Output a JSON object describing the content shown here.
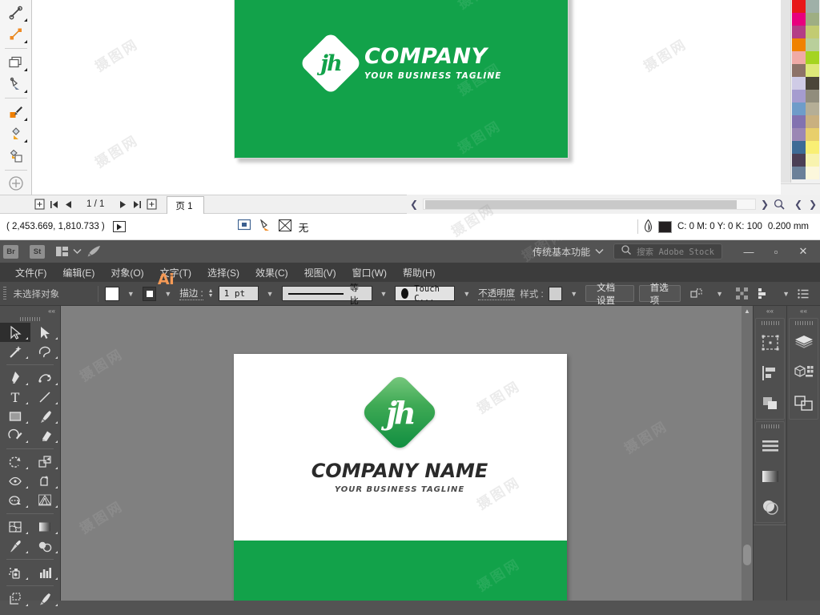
{
  "corel": {
    "toolbox": [
      {
        "name": "dimension-tool"
      },
      {
        "name": "connector-tool"
      },
      {
        "name": "rectangle-shape-tool"
      },
      {
        "name": "fill-tool"
      },
      {
        "name": "eyedropper-tool"
      },
      {
        "name": "interactive-fill-tool"
      },
      {
        "name": "smart-fill-tool"
      },
      {
        "name": "zoom-tool"
      }
    ],
    "artwork": {
      "company": "COMPANY",
      "tagline": "YOUR BUSINESS TAGLINE",
      "monogram": "jh",
      "green": "#12a24a"
    },
    "palette": {
      "left_column": [
        "#e81818",
        "#e8007d",
        "#b43d86",
        "#f08200",
        "#f0aaa6",
        "#8d7268",
        "#cfcbe6",
        "#a59ccf",
        "#6f9cc9",
        "#8272b0",
        "#9b87b4",
        "#3d6b96",
        "#4b3f55",
        "#6b8099"
      ],
      "right_column": [
        "#9fb0a8",
        "#9eae83",
        "#c2cb72",
        "#b9cf9b",
        "#a4d420",
        "#dde879",
        "#4b4539",
        "#918d7c",
        "#b5ae96",
        "#c9b07f",
        "#e8cf6b",
        "#f9ef74",
        "#f8f3ae",
        "#fcf7dc"
      ]
    },
    "pagebar": {
      "page_count": "1 / 1",
      "tab_label": "页 1"
    },
    "status": {
      "coordinates": "( 2,453.669, 1,810.733 )",
      "fill_label": "无",
      "color_values": "C: 0 M: 0 Y: 0 K: 100",
      "stroke_width": "0.200 mm",
      "swatch_color": "#231f20"
    }
  },
  "ai": {
    "titlebar": {
      "logo": "Ai",
      "bridge": "Br",
      "stock": "St",
      "workspace": "传统基本功能",
      "search_placeholder": "搜索 Adobe Stock",
      "minimize": "—",
      "maximize": "▫",
      "close": "✕"
    },
    "menus": [
      "文件(F)",
      "编辑(E)",
      "对象(O)",
      "文字(T)",
      "选择(S)",
      "效果(C)",
      "视图(V)",
      "窗口(W)",
      "帮助(H)"
    ],
    "controlbar": {
      "selection_status": "未选择对象",
      "stroke_label": "描边 :",
      "stroke_weight": "1 pt",
      "profile_label": "等比",
      "brush_label": "Touch C...",
      "opacity_label": "不透明度",
      "style_label": "样式 :",
      "document_setup": "文档设置",
      "preferences": "首选项"
    },
    "tools": [
      {
        "name": "selection-tool",
        "active": true
      },
      {
        "name": "direct-selection-tool",
        "active": false
      },
      {
        "name": "magic-wand-tool",
        "active": false
      },
      {
        "name": "lasso-tool",
        "active": false
      },
      {
        "name": "pen-tool",
        "active": false
      },
      {
        "name": "curvature-tool",
        "active": false
      },
      {
        "name": "type-tool",
        "active": false
      },
      {
        "name": "line-segment-tool",
        "active": false
      },
      {
        "name": "rectangle-tool",
        "active": false
      },
      {
        "name": "paintbrush-tool",
        "active": false
      },
      {
        "name": "shaper-tool",
        "active": false
      },
      {
        "name": "eraser-tool",
        "active": false
      },
      {
        "name": "rotate-tool",
        "active": false
      },
      {
        "name": "scale-tool",
        "active": false
      },
      {
        "name": "width-tool",
        "active": false
      },
      {
        "name": "free-transform-tool",
        "active": false
      },
      {
        "name": "shape-builder-tool",
        "active": false
      },
      {
        "name": "perspective-grid-tool",
        "active": false
      },
      {
        "name": "mesh-tool",
        "active": false
      },
      {
        "name": "gradient-tool",
        "active": false
      },
      {
        "name": "eyedropper-tool",
        "active": false
      },
      {
        "name": "blend-tool",
        "active": false
      },
      {
        "name": "symbol-sprayer-tool",
        "active": false
      },
      {
        "name": "column-graph-tool",
        "active": false
      },
      {
        "name": "artboard-tool",
        "active": false
      },
      {
        "name": "slice-tool",
        "active": false
      }
    ],
    "docks": {
      "left_column": [
        "transform-panel-icon",
        "align-panel-icon",
        "pathfinder-panel-icon",
        "paragraph-panel-icon",
        "gradient-panel-icon",
        "transparency-panel-icon"
      ],
      "right_column": [
        "layers-panel-icon",
        "symbols-panel-icon",
        "artboards-panel-icon"
      ]
    },
    "artwork": {
      "company_name": "COMPANY NAME",
      "tagline": "YOUR BUSINESS TAGLINE",
      "monogram": "jh",
      "green": "#12a24a"
    }
  },
  "watermark": "摄图网"
}
